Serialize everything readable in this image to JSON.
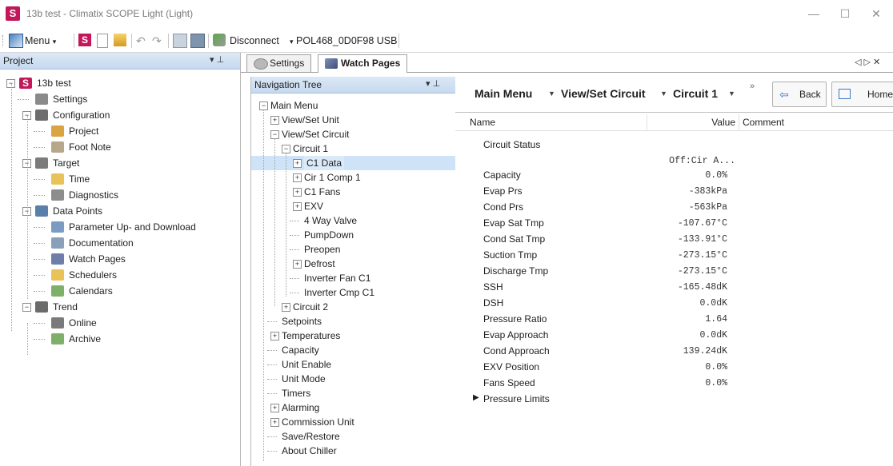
{
  "window": {
    "title": "13b test - Climatix SCOPE Light (Light)",
    "logo_letter": "S",
    "controls": {
      "minimize": "—",
      "maximize": "☐",
      "close": "✕"
    }
  },
  "toolbar": {
    "menu_label": "Menu",
    "disconnect_label": "Disconnect",
    "device_label": "POL468_0D0F98  USB"
  },
  "project_panel": {
    "header": "Project",
    "pin": "▾  ⊥",
    "items": [
      {
        "label": "13b test",
        "icon": "project-root-icon",
        "color": "#c2185b"
      },
      {
        "label": "Settings",
        "icon": "settings-icon",
        "color": "#8a8a8a"
      },
      {
        "label": "Configuration",
        "icon": "configuration-icon",
        "color": "#6d6d6d"
      },
      {
        "label": "Project",
        "icon": "project-icon",
        "color": "#d9a441"
      },
      {
        "label": "Foot Note",
        "icon": "foot-note-icon",
        "color": "#b7a78a"
      },
      {
        "label": "Target",
        "icon": "target-icon",
        "color": "#7b7b7b"
      },
      {
        "label": "Time",
        "icon": "clock-icon",
        "color": "#e9c25a"
      },
      {
        "label": "Diagnostics",
        "icon": "diagnostics-icon",
        "color": "#8d8d8d"
      },
      {
        "label": "Data Points",
        "icon": "data-points-icon",
        "color": "#5a7fa8"
      },
      {
        "label": "Parameter Up- and Download",
        "icon": "parameter-transfer-icon",
        "color": "#7a9cc2"
      },
      {
        "label": "Documentation",
        "icon": "documentation-icon",
        "color": "#8aa0b8"
      },
      {
        "label": "Watch Pages",
        "icon": "watch-pages-icon",
        "color": "#6f7ea8"
      },
      {
        "label": "Schedulers",
        "icon": "scheduler-icon",
        "color": "#e9c25a"
      },
      {
        "label": "Calendars",
        "icon": "calendar-icon",
        "color": "#7fb06a"
      },
      {
        "label": "Trend",
        "icon": "trend-icon",
        "color": "#6b6b6b"
      },
      {
        "label": "Online",
        "icon": "online-icon",
        "color": "#7a7a7a"
      },
      {
        "label": "Archive",
        "icon": "archive-icon",
        "color": "#7fb06a"
      }
    ]
  },
  "tabs": [
    {
      "label": "Settings",
      "icon": "settings-icon",
      "active": false
    },
    {
      "label": "Watch Pages",
      "icon": "watch-pages-icon",
      "active": true
    }
  ],
  "tab_scroll": "◁ ▷ ✕",
  "nav_tree": {
    "header": "Navigation Tree",
    "pin": "▾  ⊥",
    "items": [
      {
        "label": "Main Menu",
        "exp": "−"
      },
      {
        "label": "View/Set Unit",
        "exp": "+"
      },
      {
        "label": "View/Set Circuit",
        "exp": "−"
      },
      {
        "label": "Circuit 1",
        "exp": "−"
      },
      {
        "label": "C1 Data",
        "exp": "+",
        "selected": true
      },
      {
        "label": "Cir 1 Comp 1",
        "exp": "+"
      },
      {
        "label": "C1 Fans",
        "exp": "+"
      },
      {
        "label": "EXV",
        "exp": "+"
      },
      {
        "label": "4 Way Valve",
        "exp": ""
      },
      {
        "label": "PumpDown",
        "exp": ""
      },
      {
        "label": "Preopen",
        "exp": ""
      },
      {
        "label": "Defrost",
        "exp": "+"
      },
      {
        "label": "Inverter Fan C1",
        "exp": ""
      },
      {
        "label": "Inverter Cmp C1",
        "exp": ""
      },
      {
        "label": "Circuit 2",
        "exp": "+"
      },
      {
        "label": "Setpoints",
        "exp": ""
      },
      {
        "label": "Temperatures",
        "exp": "+"
      },
      {
        "label": "Capacity",
        "exp": ""
      },
      {
        "label": "Unit Enable",
        "exp": ""
      },
      {
        "label": "Unit Mode",
        "exp": ""
      },
      {
        "label": "Timers",
        "exp": ""
      },
      {
        "label": "Alarming",
        "exp": "+"
      },
      {
        "label": "Commission Unit",
        "exp": "+"
      },
      {
        "label": "Save/Restore",
        "exp": ""
      },
      {
        "label": "About Chiller",
        "exp": ""
      }
    ]
  },
  "breadcrumb": {
    "items": [
      "Main Menu",
      "View/Set Circuit",
      "Circuit 1"
    ],
    "overflow": "»",
    "back_label": "Back",
    "home_label": "Home"
  },
  "grid": {
    "headers": {
      "name": "Name",
      "value": "Value",
      "comment": "Comment"
    },
    "rows": [
      {
        "name": "Circuit Status",
        "value": ""
      },
      {
        "name": "",
        "value": "Off:Cir A..."
      },
      {
        "name": "Capacity",
        "value": "0.0%"
      },
      {
        "name": "Evap Prs",
        "value": "-383kPa"
      },
      {
        "name": "Cond Prs",
        "value": "-563kPa"
      },
      {
        "name": "Evap Sat Tmp",
        "value": "-107.67°C"
      },
      {
        "name": "Cond Sat Tmp",
        "value": "-133.91°C"
      },
      {
        "name": "Suction Tmp",
        "value": "-273.15°C"
      },
      {
        "name": "Discharge Tmp",
        "value": "-273.15°C"
      },
      {
        "name": "SSH",
        "value": "-165.48dK"
      },
      {
        "name": "DSH",
        "value": "0.0dK"
      },
      {
        "name": "Pressure Ratio",
        "value": "1.64"
      },
      {
        "name": "Evap Approach",
        "value": "0.0dK"
      },
      {
        "name": "Cond Approach",
        "value": "139.24dK"
      },
      {
        "name": "EXV Position",
        "value": "0.0%"
      },
      {
        "name": "Fans Speed",
        "value": "0.0%"
      }
    ],
    "group_row": {
      "arrow": "▶",
      "label": "Pressure Limits"
    }
  }
}
